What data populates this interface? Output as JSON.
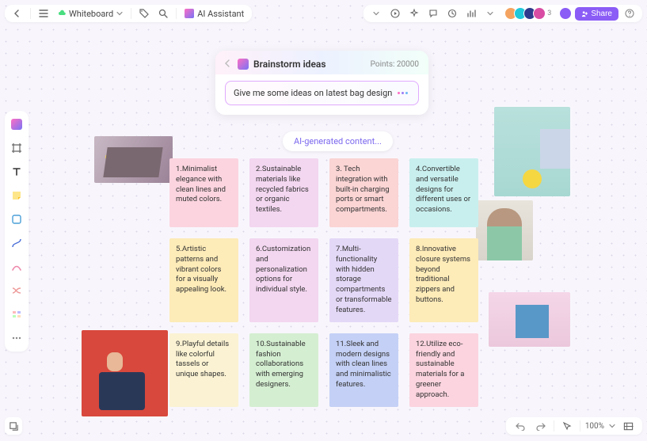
{
  "topbar": {
    "doc_name": "Whiteboard",
    "ai_label": "AI Assistant"
  },
  "topbar_right": {
    "avatar_extra": "3",
    "share_label": "Share"
  },
  "ai_card": {
    "title": "Brainstorm ideas",
    "points_label": "Points:",
    "points_value": "20000",
    "prompt_text": "Give me some ideas on latest bag design"
  },
  "ai_chip": "AI-generated content...",
  "ideas": {
    "r1": [
      {
        "text": "1.Minimalist elegance with clean lines and muted colors.",
        "color": "c-pink"
      },
      {
        "text": "2.Sustainable materials like recycled fabrics or organic textiles.",
        "color": "c-lpink"
      },
      {
        "text": "3. Tech integration with built-in charging ports or smart compartments.",
        "color": "c-salmon"
      },
      {
        "text": "4.Convertible and versatile designs for different uses or occasions.",
        "color": "c-cyan"
      }
    ],
    "r2": [
      {
        "text": "5.Artistic patterns and vibrant colors for a visually appealing look.",
        "color": "c-yellow"
      },
      {
        "text": "6.Customization and personalization options for individual style.",
        "color": "c-lpink"
      },
      {
        "text": "7.Multi-functionality with hidden storage compartments or transformable features.",
        "color": "c-lilac"
      },
      {
        "text": "8.Innovative closure systems beyond traditional zippers and buttons.",
        "color": "c-yellow"
      }
    ],
    "r3": [
      {
        "text": "9.Playful details like colorful tassels or unique shapes.",
        "color": "c-cream"
      },
      {
        "text": "10.Sustainable fashion collaborations with emerging designers.",
        "color": "c-green"
      },
      {
        "text": "11.Sleek and modern designs with clean lines and minimalistic features.",
        "color": "c-blue"
      },
      {
        "text": "12.Utilize eco-friendly and sustainable materials for a greener approach.",
        "color": "c-pink"
      }
    ]
  },
  "zoom": {
    "label": "100%"
  }
}
